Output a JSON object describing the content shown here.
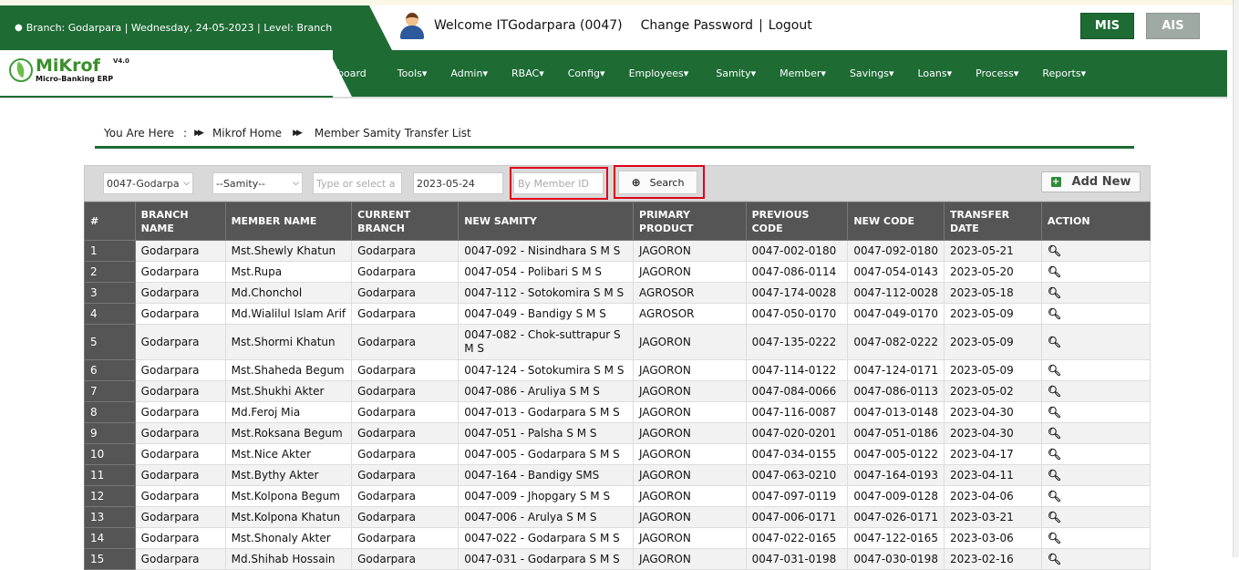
{
  "top": {
    "branch_info": "Branch: Godarpara | Wednesday, 24-05-2023 | Level: Branch",
    "welcome": "Welcome ITGodarpara (0047)",
    "change_password": "Change Password",
    "separator": "|",
    "logout": "Logout",
    "mis": "MIS",
    "ais": "AIS"
  },
  "logo": {
    "name_a": "Mi",
    "name_b": "Krof",
    "version": "V4.0",
    "tagline": "Micro-Banking ERP"
  },
  "menu": [
    "board",
    "Tools",
    "Admin",
    "RBAC",
    "Config",
    "Employees",
    "Samity",
    "Member",
    "Savings",
    "Loans",
    "Process",
    "Reports"
  ],
  "breadcrumb": {
    "you_are_here": "You Are Here",
    "colon": ":",
    "home": "Mikrof Home",
    "current": "Member Samity Transfer List"
  },
  "filters": {
    "branch": "0047-Godarpa",
    "samity": "--Samity--",
    "member_placeholder": "Type or select a",
    "date": "2023-05-24",
    "member_id_placeholder": "By Member ID",
    "search": "Search",
    "add_new": "Add New"
  },
  "table": {
    "headers": [
      "#",
      "BRANCH NAME",
      "MEMBER NAME",
      "CURRENT BRANCH",
      "NEW SAMITY",
      "PRIMARY PRODUCT",
      "PREVIOUS CODE",
      "NEW CODE",
      "TRANSFER DATE",
      "ACTION"
    ],
    "rows": [
      [
        "1",
        "Godarpara",
        "Mst.Shewly Khatun",
        "Godarpara",
        "0047-092 - Nisindhara S M S",
        "JAGORON",
        "0047-002-0180",
        "0047-092-0180",
        "2023-05-21"
      ],
      [
        "2",
        "Godarpara",
        "Mst.Rupa",
        "Godarpara",
        "0047-054 - Polibari S M S",
        "JAGORON",
        "0047-086-0114",
        "0047-054-0143",
        "2023-05-20"
      ],
      [
        "3",
        "Godarpara",
        "Md.Chonchol",
        "Godarpara",
        "0047-112 - Sotokomira S M S",
        "AGROSOR",
        "0047-174-0028",
        "0047-112-0028",
        "2023-05-18"
      ],
      [
        "4",
        "Godarpara",
        "Md.Wialilul Islam Arif",
        "Godarpara",
        "0047-049 - Bandigy S M S",
        "AGROSOR",
        "0047-050-0170",
        "0047-049-0170",
        "2023-05-09"
      ],
      [
        "5",
        "Godarpara",
        "Mst.Shormi Khatun",
        "Godarpara",
        "0047-082 - Chok-suttrapur S M S",
        "JAGORON",
        "0047-135-0222",
        "0047-082-0222",
        "2023-05-09"
      ],
      [
        "6",
        "Godarpara",
        "Mst.Shaheda Begum",
        "Godarpara",
        "0047-124 - Sotokumira S M S",
        "JAGORON",
        "0047-114-0122",
        "0047-124-0171",
        "2023-05-09"
      ],
      [
        "7",
        "Godarpara",
        "Mst.Shukhi Akter",
        "Godarpara",
        "0047-086 - Aruliya S M S",
        "JAGORON",
        "0047-084-0066",
        "0047-086-0113",
        "2023-05-02"
      ],
      [
        "8",
        "Godarpara",
        "Md.Feroj Mia",
        "Godarpara",
        "0047-013 - Godarpara S M S",
        "JAGORON",
        "0047-116-0087",
        "0047-013-0148",
        "2023-04-30"
      ],
      [
        "9",
        "Godarpara",
        "Mst.Roksana Begum",
        "Godarpara",
        "0047-051 - Palsha S M S",
        "JAGORON",
        "0047-020-0201",
        "0047-051-0186",
        "2023-04-30"
      ],
      [
        "10",
        "Godarpara",
        "Mst.Nice Akter",
        "Godarpara",
        "0047-005 - Godarpara S M S",
        "JAGORON",
        "0047-034-0155",
        "0047-005-0122",
        "2023-04-17"
      ],
      [
        "11",
        "Godarpara",
        "Mst.Bythy Akter",
        "Godarpara",
        "0047-164 - Bandigy SMS",
        "JAGORON",
        "0047-063-0210",
        "0047-164-0193",
        "2023-04-11"
      ],
      [
        "12",
        "Godarpara",
        "Mst.Kolpona Begum",
        "Godarpara",
        "0047-009 - Jhopgary S M S",
        "JAGORON",
        "0047-097-0119",
        "0047-009-0128",
        "2023-04-06"
      ],
      [
        "13",
        "Godarpara",
        "Mst.Kolpona Khatun",
        "Godarpara",
        "0047-006 - Arulya S M S",
        "JAGORON",
        "0047-006-0171",
        "0047-026-0171",
        "2023-03-21"
      ],
      [
        "14",
        "Godarpara",
        "Mst.Shonaly Akter",
        "Godarpara",
        "0047-022 - Godarpara S M S",
        "JAGORON",
        "0047-022-0165",
        "0047-122-0165",
        "2023-03-06"
      ],
      [
        "15",
        "Godarpara",
        "Md.Shihab Hossain",
        "Godarpara",
        "0047-031 - Godarpara S M S",
        "JAGORON",
        "0047-031-0198",
        "0047-030-0198",
        "2023-02-16"
      ]
    ]
  },
  "colors": {
    "brand_green": "#1e6b34",
    "header_gray": "#555555",
    "highlight_red": "#e0001a"
  }
}
